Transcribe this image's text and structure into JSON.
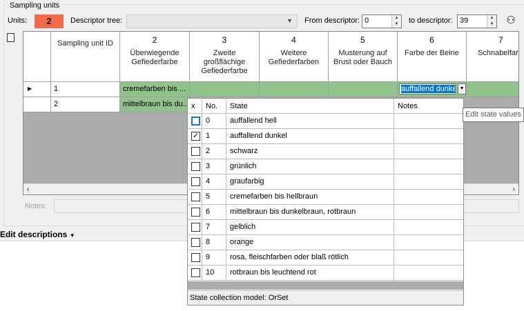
{
  "group": {
    "title": "Sampling units"
  },
  "toolbar": {
    "units_label": "Units:",
    "units_count": "2",
    "descriptor_tree_label": "Descriptor tree:",
    "descriptor_tree_value": "",
    "from_label": "From descriptor:",
    "from_value": "0",
    "to_label": "to descriptor:",
    "to_value": "39"
  },
  "grid": {
    "columns": [
      {
        "num": "",
        "text": "Sampling unit ID"
      },
      {
        "num": "2",
        "text": "Überwiegende Gefiederfarbe"
      },
      {
        "num": "3",
        "text": "Zweite großflächige Gefiederfarbe"
      },
      {
        "num": "4",
        "text": "Weitere Gefiederfarben"
      },
      {
        "num": "5",
        "text": "Musterung auf Brust oder Bauch"
      },
      {
        "num": "6",
        "text": "Farbe der Beine"
      },
      {
        "num": "7",
        "text": "Schnabelfarbe"
      }
    ],
    "rows": [
      {
        "marker": "▶",
        "id": "1",
        "c2": "cremefarben bis ...",
        "c6": "auffallend dunkel"
      },
      {
        "marker": "",
        "id": "2",
        "c2": "mittelbraun bis du..."
      }
    ]
  },
  "notes": {
    "label": "Notes:"
  },
  "edit_descriptions": {
    "label": "Edit descriptions"
  },
  "popup": {
    "headers": {
      "x": "x",
      "no": "No.",
      "state": "State",
      "notes": "Notes"
    },
    "states": [
      {
        "no": "0",
        "state": "auffallend hell",
        "checked": false
      },
      {
        "no": "1",
        "state": "auffallend dunkel",
        "checked": true
      },
      {
        "no": "2",
        "state": "schwarz",
        "checked": false
      },
      {
        "no": "3",
        "state": "grünlich",
        "checked": false
      },
      {
        "no": "4",
        "state": "graufarbig",
        "checked": false
      },
      {
        "no": "5",
        "state": "cremefarben bis hellbraun",
        "checked": false
      },
      {
        "no": "6",
        "state": "mittelbraun bis dunkelbraun, rotbraun",
        "checked": false
      },
      {
        "no": "7",
        "state": "gelblich",
        "checked": false
      },
      {
        "no": "8",
        "state": "orange",
        "checked": false
      },
      {
        "no": "9",
        "state": "rosa, fleischfarben oder blaß rötlich",
        "checked": false
      },
      {
        "no": "10",
        "state": "rotbraun bis leuchtend rot",
        "checked": false
      }
    ],
    "footer": "State collection model:  OrSet"
  },
  "tooltip": {
    "text": "Edit state values"
  }
}
